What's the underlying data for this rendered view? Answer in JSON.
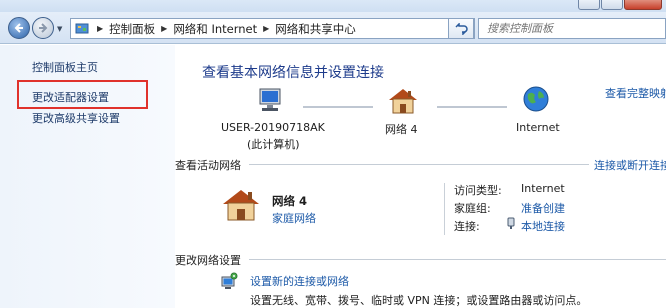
{
  "window": {
    "buttons": [
      "minimize",
      "maximize",
      "close"
    ]
  },
  "address_bar": {
    "breadcrumbs": [
      "控制面板",
      "网络和 Internet",
      "网络和共享中心"
    ],
    "search_placeholder": "搜索控制面板"
  },
  "sidebar": {
    "items": [
      {
        "label": "控制面板主页",
        "highlighted": false
      },
      {
        "label": "更改适配器设置",
        "highlighted": true
      },
      {
        "label": "更改高级共享设置",
        "highlighted": false
      }
    ],
    "highlight_color": "#e0322c"
  },
  "main": {
    "title": "查看基本网络信息并设置连接",
    "see_full_map": "查看完整映射",
    "map": {
      "computer": {
        "name": "USER-20190718AK",
        "sub": "(此计算机)"
      },
      "network": {
        "name": "网络  4"
      },
      "internet": {
        "name": "Internet"
      }
    },
    "active_networks": {
      "heading": "查看活动网络",
      "connect_link": "连接或断开连接",
      "network_name": "网络  4",
      "network_type": "家庭网络",
      "details": [
        {
          "key": "访问类型:",
          "value": "Internet",
          "link": false
        },
        {
          "key": "家庭组:",
          "value": "准备创建",
          "link": true
        },
        {
          "key": "连接:",
          "value": "本地连接",
          "link": true
        }
      ]
    },
    "change_settings": {
      "heading": "更改网络设置",
      "task_title": "设置新的连接或网络",
      "task_desc": "设置无线、宽带、拨号、临时或 VPN 连接；或设置路由器或访问点。"
    }
  },
  "colors": {
    "link": "#1d5aa8",
    "title": "#1d3b8b"
  }
}
